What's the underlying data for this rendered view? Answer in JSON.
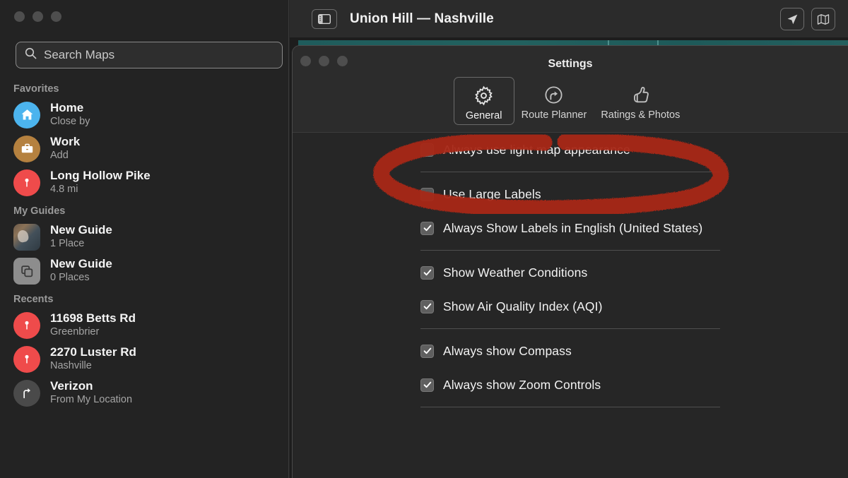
{
  "map_window": {
    "title": "Union Hill — Nashville",
    "sidebar_toggle_icon": "sidebar-toggle-icon",
    "location_icon": "location-arrow-icon",
    "map_mode_icon": "map-icon"
  },
  "sidebar": {
    "search": {
      "placeholder": "Search Maps",
      "value": "",
      "icon": "search-icon"
    },
    "sections": [
      {
        "header": "Favorites",
        "items": [
          {
            "title": "Home",
            "subtitle": "Close by",
            "icon": "home-icon",
            "icon_style": "ic-home"
          },
          {
            "title": "Work",
            "subtitle": "Add",
            "icon": "briefcase-icon",
            "icon_style": "ic-work"
          },
          {
            "title": "Long Hollow Pike",
            "subtitle": "4.8 mi",
            "icon": "map-pin-icon",
            "icon_style": "ic-pin"
          }
        ]
      },
      {
        "header": "My Guides",
        "items": [
          {
            "title": "New Guide",
            "subtitle": "1 Place",
            "icon": "guide-photo-thumbnail",
            "icon_style": "ic-photo"
          },
          {
            "title": "New Guide",
            "subtitle": "0 Places",
            "icon": "stacked-squares-icon",
            "icon_style": "ic-gray"
          }
        ]
      },
      {
        "header": "Recents",
        "items": [
          {
            "title": "11698 Betts Rd",
            "subtitle": "Greenbrier",
            "icon": "map-pin-icon",
            "icon_style": "ic-pin"
          },
          {
            "title": "2270 Luster Rd",
            "subtitle": "Nashville",
            "icon": "map-pin-icon",
            "icon_style": "ic-pin"
          },
          {
            "title": "Verizon",
            "subtitle": "From My Location",
            "icon": "turn-right-icon",
            "icon_style": "ic-dirs"
          }
        ]
      }
    ]
  },
  "settings": {
    "title": "Settings",
    "toolbar": [
      {
        "label": "General",
        "icon": "gear-icon",
        "selected": true
      },
      {
        "label": "Route Planner",
        "icon": "route-arrow-icon",
        "selected": false
      },
      {
        "label": "Ratings & Photos",
        "icon": "thumbs-up-icon",
        "selected": false
      }
    ],
    "groups": [
      {
        "options": [
          {
            "label": "Always use light map appearance",
            "checked": false
          }
        ]
      },
      {
        "options": [
          {
            "label": "Use Large Labels",
            "checked": false
          },
          {
            "label": "Always Show Labels in English (United States)",
            "checked": true
          }
        ]
      },
      {
        "options": [
          {
            "label": "Show Weather Conditions",
            "checked": true
          },
          {
            "label": "Show Air Quality Index (AQI)",
            "checked": true
          }
        ]
      },
      {
        "options": [
          {
            "label": "Always show Compass",
            "checked": true
          },
          {
            "label": "Always show Zoom Controls",
            "checked": true
          }
        ]
      }
    ]
  },
  "annotation": {
    "shape": "hand-drawn-ellipse",
    "color": "#a82617",
    "targets": "Always use light map appearance"
  }
}
